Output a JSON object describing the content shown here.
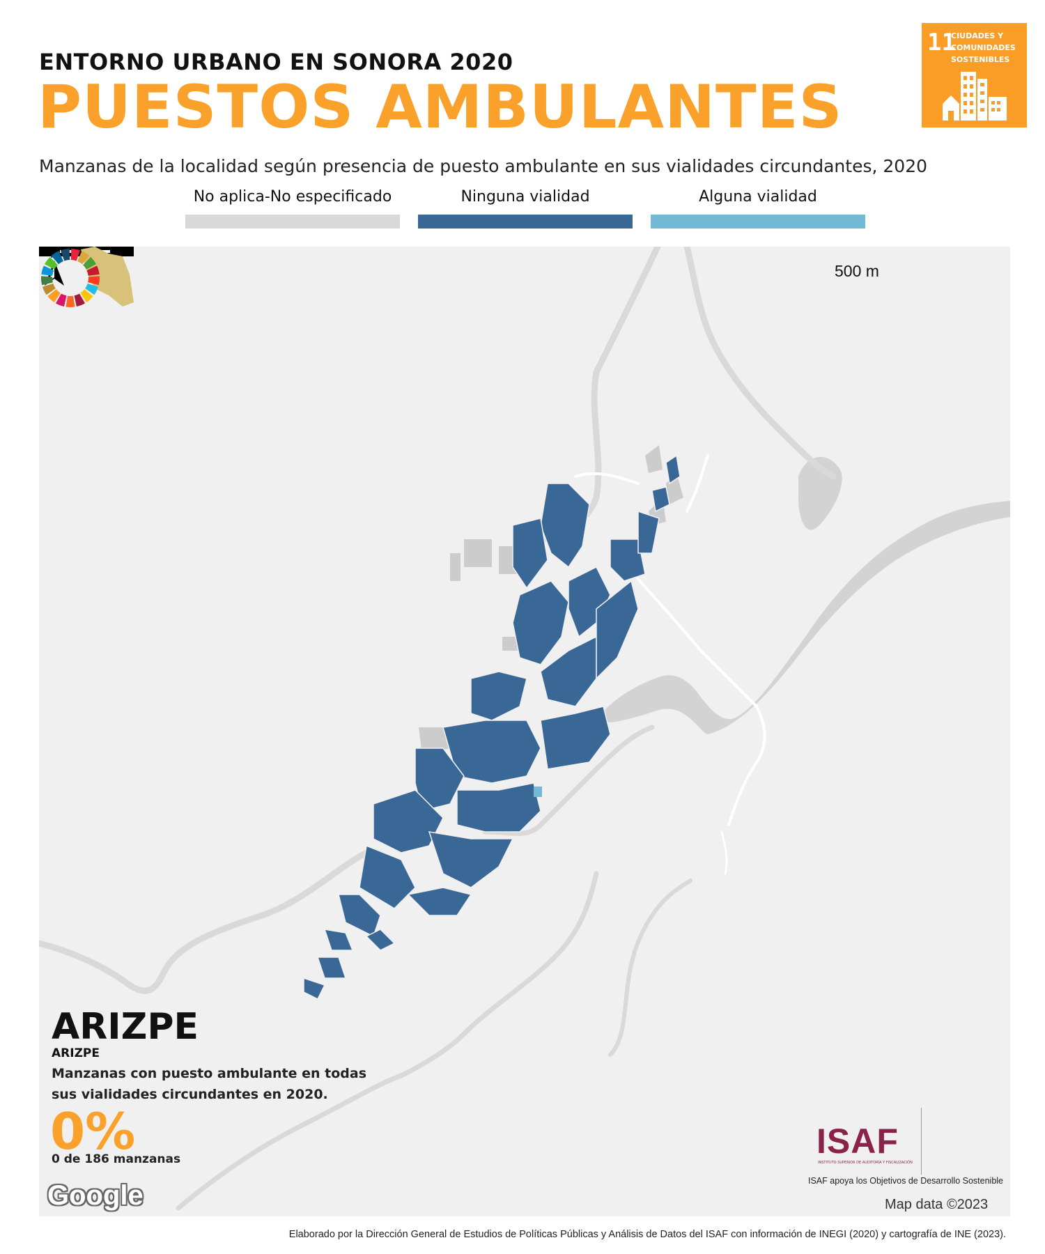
{
  "header": {
    "kicker": "ENTORNO URBANO EN SONORA 2020",
    "title": "PUESTOS AMBULANTES",
    "subtitle": "Manzanas de la localidad según presencia de puesto ambulante en sus vialidades circundantes, 2020"
  },
  "sdg_badge": {
    "number": "11",
    "text": "CIUDADES Y COMUNIDADES SOSTENIBLES",
    "color": "#f99d26"
  },
  "legend": [
    {
      "label": "No aplica-No especificado",
      "color": "#d9d9d9"
    },
    {
      "label": "Ninguna vialidad",
      "color": "#3a6896"
    },
    {
      "label": "Alguna vialidad",
      "color": "#72b9d3"
    }
  ],
  "map": {
    "scale_label": "500 m",
    "north_label": "N",
    "north_icon": "north-arrow-icon",
    "background_color": "#f0f0f0",
    "river_color": "#d3d3d3",
    "road_color": "#ffffff",
    "block_color": "#3a6896",
    "highlight_color": "#72b9d3",
    "attribution_logo": "Google",
    "attribution": "Map data ©2023"
  },
  "info": {
    "place_name": "ARIZPE",
    "place_sub": "ARIZPE",
    "description": "Manzanas con puesto ambulante en todas sus vialidades circundantes en 2020.",
    "percentage": "0%",
    "count": "0 de 186 manzanas"
  },
  "logos": {
    "isaf": "ISAF",
    "isaf_small": "INSTITUTO SUPERIOR DE AUDITORÍA Y FISCALIZACIÓN",
    "isaf_color": "#8a2249",
    "caption": "ISAF apoya los Objetivos de Desarrollo Sostenible"
  },
  "footer": "Elaborado por la Dirección General de Estudios de Políticas Públicas y Análisis de Datos del ISAF con información de INEGI (2020) y cartografía de INE (2023)."
}
